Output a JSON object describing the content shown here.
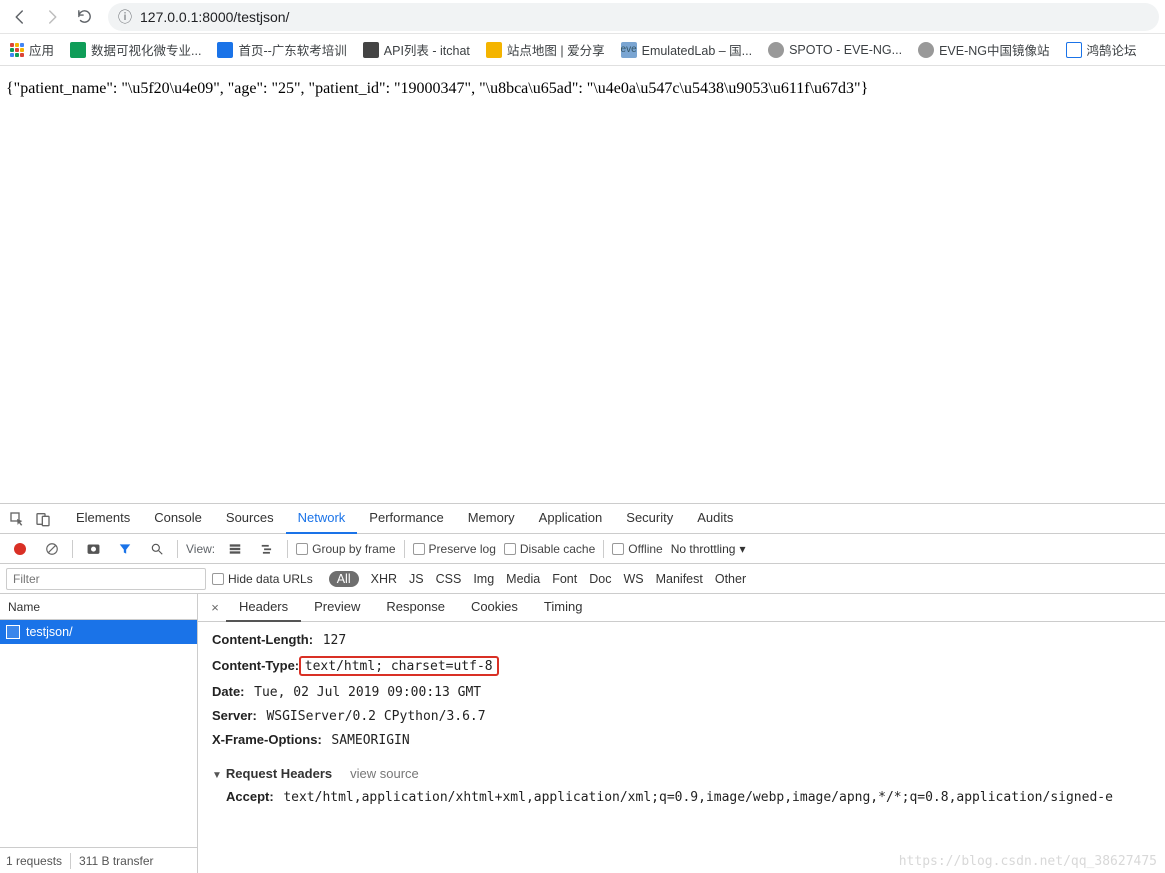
{
  "nav": {
    "url": "127.0.0.1:8000/testjson/"
  },
  "bookmarks": {
    "apps": "应用",
    "items": [
      {
        "label": "数据可视化微专业...",
        "color": "#0f9d58"
      },
      {
        "label": "首页--广东软考培训",
        "color": "#1a73e8"
      },
      {
        "label": "API列表 - itchat",
        "color": "#444"
      },
      {
        "label": "站点地图 | 爱分享",
        "color": "#f4b400"
      },
      {
        "label": "EmulatedLab – 国...",
        "color": "#7aa5d2"
      },
      {
        "label": "SPOTO - EVE-NG...",
        "color": "#555"
      },
      {
        "label": "EVE-NG中国镜像站",
        "color": "#555"
      },
      {
        "label": "鸿鹄论坛",
        "color": "#1a73e8"
      }
    ]
  },
  "page": {
    "body": "{\"patient_name\": \"\\u5f20\\u4e09\", \"age\": \"25\", \"patient_id\": \"19000347\", \"\\u8bca\\u65ad\": \"\\u4e0a\\u547c\\u5438\\u9053\\u611f\\u67d3\"}"
  },
  "devtools": {
    "mainTabs": [
      "Elements",
      "Console",
      "Sources",
      "Network",
      "Performance",
      "Memory",
      "Application",
      "Security",
      "Audits"
    ],
    "activeMainTab": "Network",
    "toolbar": {
      "view": "View:",
      "group": "Group by frame",
      "preserve": "Preserve log",
      "disableCache": "Disable cache",
      "offline": "Offline",
      "throttle": "No throttling"
    },
    "filterPlaceholder": "Filter",
    "hideDataUrls": "Hide data URLs",
    "resourceTypes": [
      "All",
      "XHR",
      "JS",
      "CSS",
      "Img",
      "Media",
      "Font",
      "Doc",
      "WS",
      "Manifest",
      "Other"
    ],
    "leftHeader": "Name",
    "requests": [
      {
        "name": "testjson/"
      }
    ],
    "leftFooter": {
      "reqs": "1 requests",
      "transfer": "311 B transfer"
    },
    "panelTabs": [
      "Headers",
      "Preview",
      "Response",
      "Cookies",
      "Timing"
    ],
    "activePanelTab": "Headers",
    "headers": {
      "contentLengthKey": "Content-Length:",
      "contentLengthVal": "127",
      "contentTypeKey": "Content-Type:",
      "contentTypeVal": "text/html; charset=utf-8",
      "dateKey": "Date:",
      "dateVal": "Tue, 02 Jul 2019 09:00:13 GMT",
      "serverKey": "Server:",
      "serverVal": "WSGIServer/0.2 CPython/3.6.7",
      "xfoKey": "X-Frame-Options:",
      "xfoVal": "SAMEORIGIN",
      "requestHeadersTitle": "Request Headers",
      "viewSource": "view source",
      "acceptKey": "Accept:",
      "acceptVal": "text/html,application/xhtml+xml,application/xml;q=0.9,image/webp,image/apng,*/*;q=0.8,application/signed-e"
    }
  },
  "watermark": "https://blog.csdn.net/qq_38627475"
}
